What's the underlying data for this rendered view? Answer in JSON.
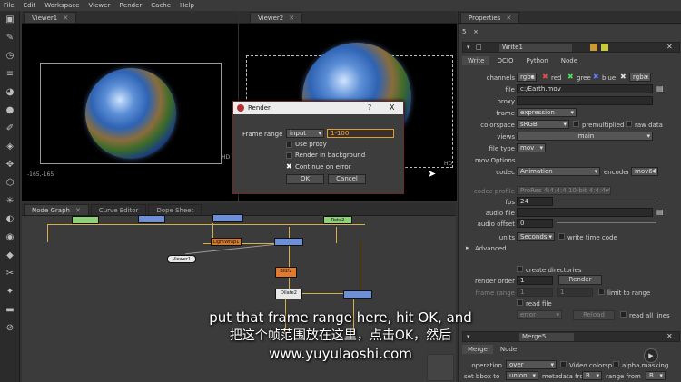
{
  "menubar": {
    "items": [
      "File",
      "Edit",
      "Workspace",
      "Viewer",
      "Render",
      "Cache",
      "Help"
    ]
  },
  "viewer1": {
    "tab_label": "Viewer1",
    "coords": "-165,-165",
    "format_label": "HD"
  },
  "viewer2": {
    "tab_label": "Viewer2",
    "format_label": "HD"
  },
  "render_dialog": {
    "title": "Render",
    "help": "?",
    "close": "X",
    "frame_range_label": "Frame range",
    "frame_range_mode": "input",
    "frame_range_value": "1-100",
    "use_proxy_label": "Use proxy",
    "render_background_label": "Render in background",
    "continue_on_error_label": "Continue on error",
    "continue_on_error_checked": true,
    "ok_label": "OK",
    "cancel_label": "Cancel"
  },
  "nodegraph": {
    "tabs": [
      "Node Graph",
      "Curve Editor",
      "Dope Sheet"
    ],
    "nodes": {
      "viewer1": "Viewer1",
      "blur": "Blur2",
      "dilate": "Dilate2",
      "light": "LightWrap1",
      "roto": "Roto2"
    }
  },
  "properties": {
    "panel_title": "Properties",
    "top_count": "5",
    "node_name": "Write1",
    "tabs": [
      "Write",
      "OCIO",
      "Python",
      "Node"
    ],
    "channels_label": "channels",
    "channels_value": "rgba",
    "channel_red": "red",
    "channel_green": "gree",
    "channel_blue": "blue",
    "channel_alpha": "rgba.",
    "file_label": "file",
    "file_value": "c:/Earth.mov",
    "proxy_label": "proxy",
    "frame_label": "frame",
    "frame_value": "expression",
    "colorspace_label": "colorspace",
    "colorspace_value": "sRGB",
    "premultiplied_label": "premultiplied",
    "raw_data_label": "raw data",
    "views_label": "views",
    "views_value": "main",
    "file_type_label": "file type",
    "file_type_value": "mov",
    "mov_options_label": "mov Options",
    "codec_label": "codec",
    "codec_value": "Animation",
    "encoder_label": "encoder",
    "encoder_value": "mov64",
    "codec_profile_label": "codec profile",
    "codec_profile_value": "ProRes 4:4:4:4 10-bit 4:4:4:4/Mbit",
    "fps_label": "fps",
    "fps_value": "24",
    "audio_file_label": "audio file",
    "audio_offset_label": "audio offset",
    "audio_offset_value": "0",
    "units_label": "units",
    "units_value": "Seconds",
    "write_time_code_label": "write time code",
    "advanced_label": "Advanced",
    "create_directories_label": "create directories",
    "render_order_label": "render order",
    "render_order_value": "1",
    "render_button": "Render",
    "frame_range_label": "frame range",
    "frame_range_a": "1",
    "frame_range_b": "1",
    "limit_to_range_label": "limit to range",
    "read_file_label": "read file",
    "error_label": "error",
    "reload_label": "Reload",
    "read_all_lines_label": "read all lines",
    "merge_node_name": "Merge5",
    "merge_tabs": [
      "Merge",
      "Node"
    ],
    "operation_label": "operation",
    "operation_value": "over",
    "video_colorspace_label": "Video colorsp",
    "alpha_masking_label": "alpha masking",
    "set_bbox_label": "set bbox to",
    "set_bbox_value": "union",
    "metadata_label": "metadata fro",
    "metadata_value": "B",
    "range_from_label": "range from",
    "range_from_value": "B"
  },
  "subtitle": {
    "line1": "put that frame range here, hit OK, and",
    "line2": "把这个帧范围放在这里，点击OK，然后",
    "line3": "www.yuyulaoshi.com"
  }
}
